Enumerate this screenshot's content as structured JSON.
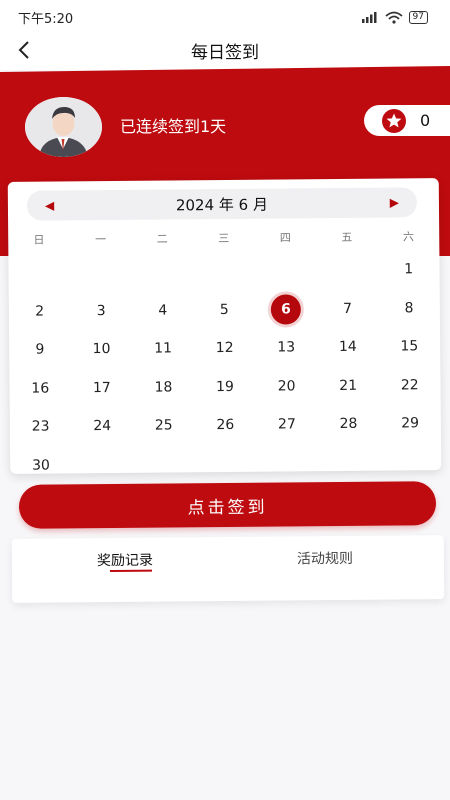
{
  "status_bar": {
    "time": "下午5:20",
    "battery": "97"
  },
  "nav": {
    "title": "每日签到"
  },
  "profile": {
    "streak_text": "已连续签到1天",
    "points": "0"
  },
  "calendar": {
    "month_label": "2024 年 6 月",
    "prev_arrow": "◀",
    "next_arrow": "▶",
    "weekdays": [
      "日",
      "一",
      "二",
      "三",
      "四",
      "五",
      "六"
    ],
    "leading_blanks": 6,
    "days": [
      "1",
      "2",
      "3",
      "4",
      "5",
      "6",
      "7",
      "8",
      "9",
      "10",
      "11",
      "12",
      "13",
      "14",
      "15",
      "16",
      "17",
      "18",
      "19",
      "20",
      "21",
      "22",
      "23",
      "24",
      "25",
      "26",
      "27",
      "28",
      "29",
      "30"
    ],
    "today": "6"
  },
  "checkin_button": {
    "label": "点击签到"
  },
  "tabs": {
    "rewards": "奖励记录",
    "rules": "活动规则"
  },
  "colors": {
    "brand_red": "#be0b0f"
  }
}
